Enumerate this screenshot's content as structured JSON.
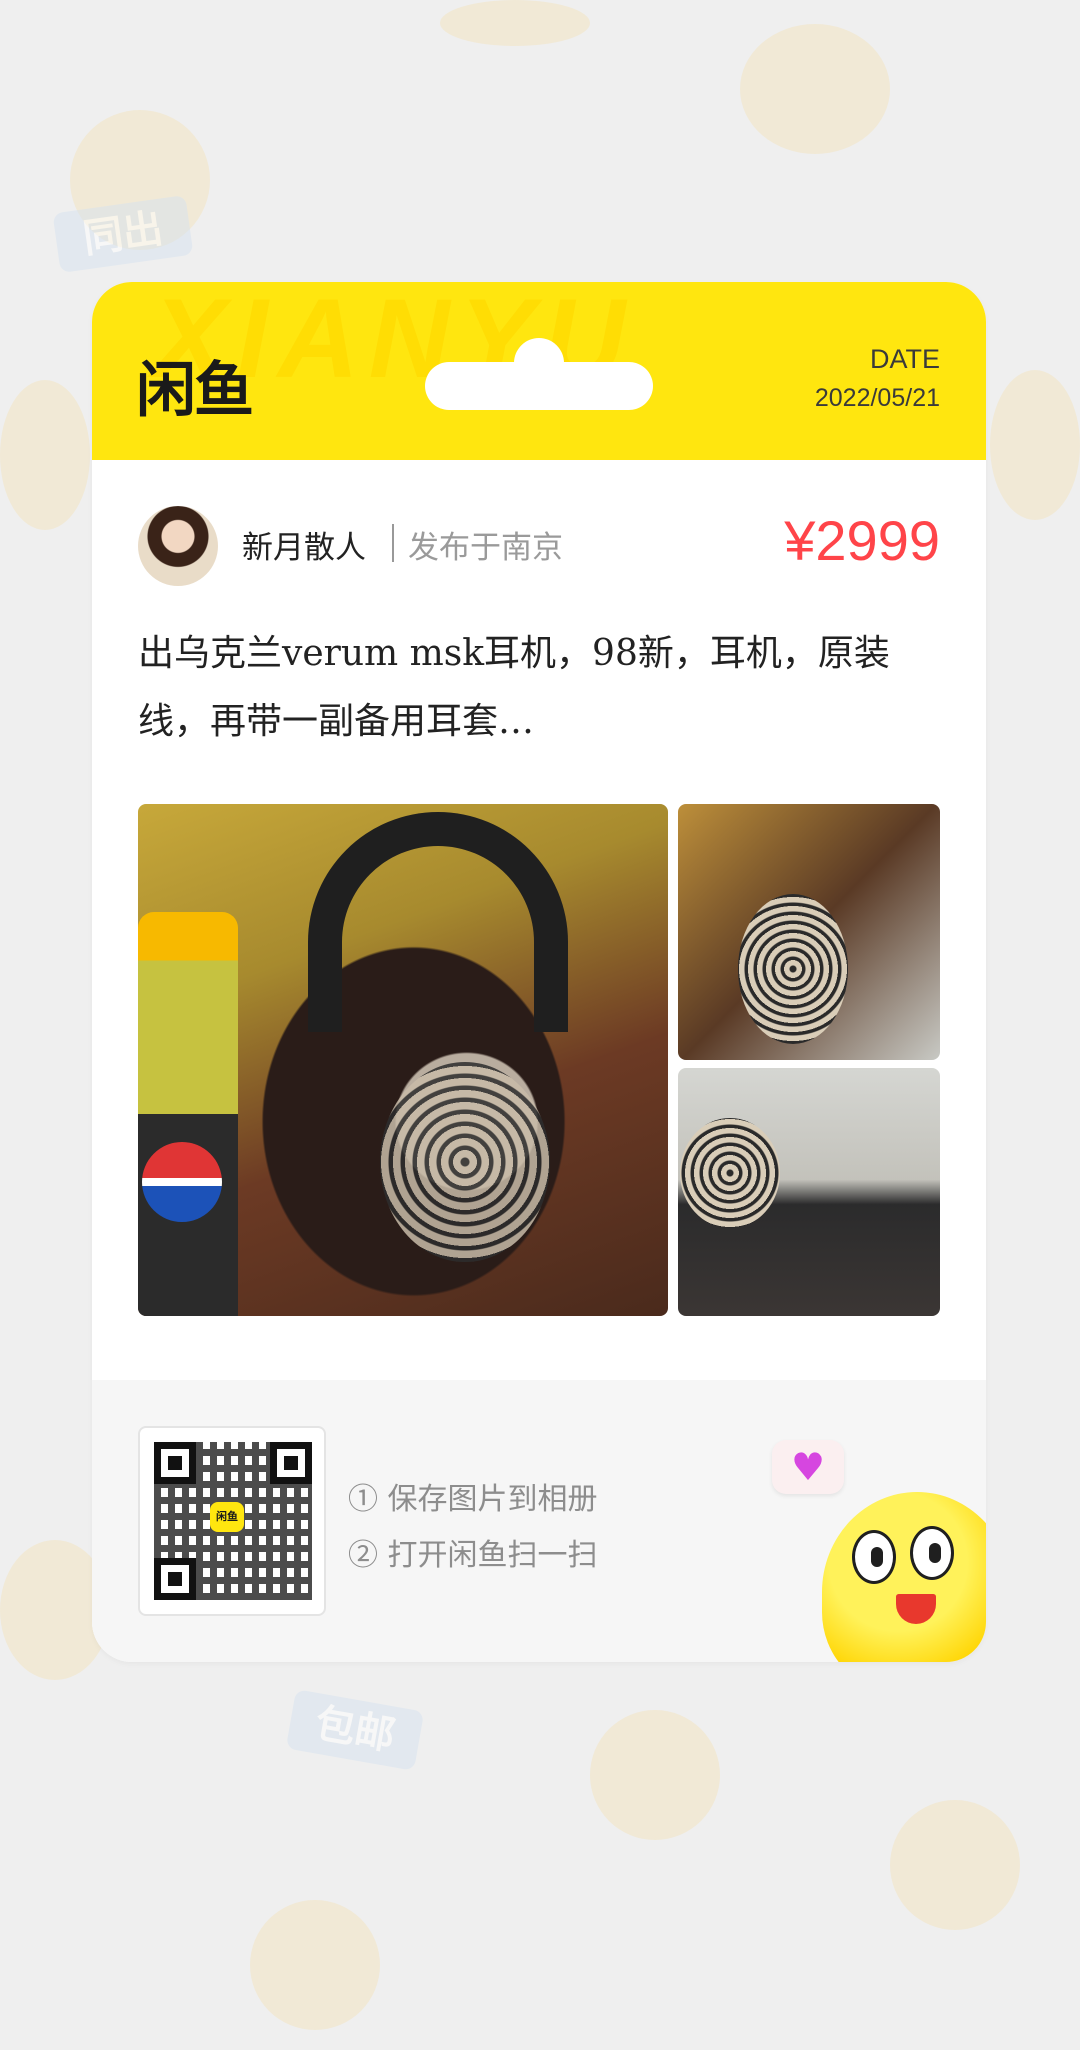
{
  "background": {
    "badges": [
      "同出",
      "包邮"
    ]
  },
  "header": {
    "watermark": "XIANYU",
    "logo": "闲鱼",
    "date_label": "DATE",
    "date_value": "2022/05/21"
  },
  "listing": {
    "seller_name": "新月散人",
    "location": "发布于南京",
    "price": "¥2999",
    "description": "出乌克兰verum msk耳机，98新，耳机，原装线，再带一副备用耳套…",
    "photos": [
      "headphones-on-stand-with-pepsi-bottle",
      "headphones-side-view",
      "headphones-on-case"
    ]
  },
  "footer": {
    "qr_logo": "闲鱼",
    "step_1": "① 保存图片到相册",
    "step_2": "② 打开闲鱼扫一扫",
    "bubble_icon": "heart-icon"
  },
  "colors": {
    "brand_yellow": "#ffe60f",
    "price_red": "#ff4449",
    "background": "#efefef"
  }
}
